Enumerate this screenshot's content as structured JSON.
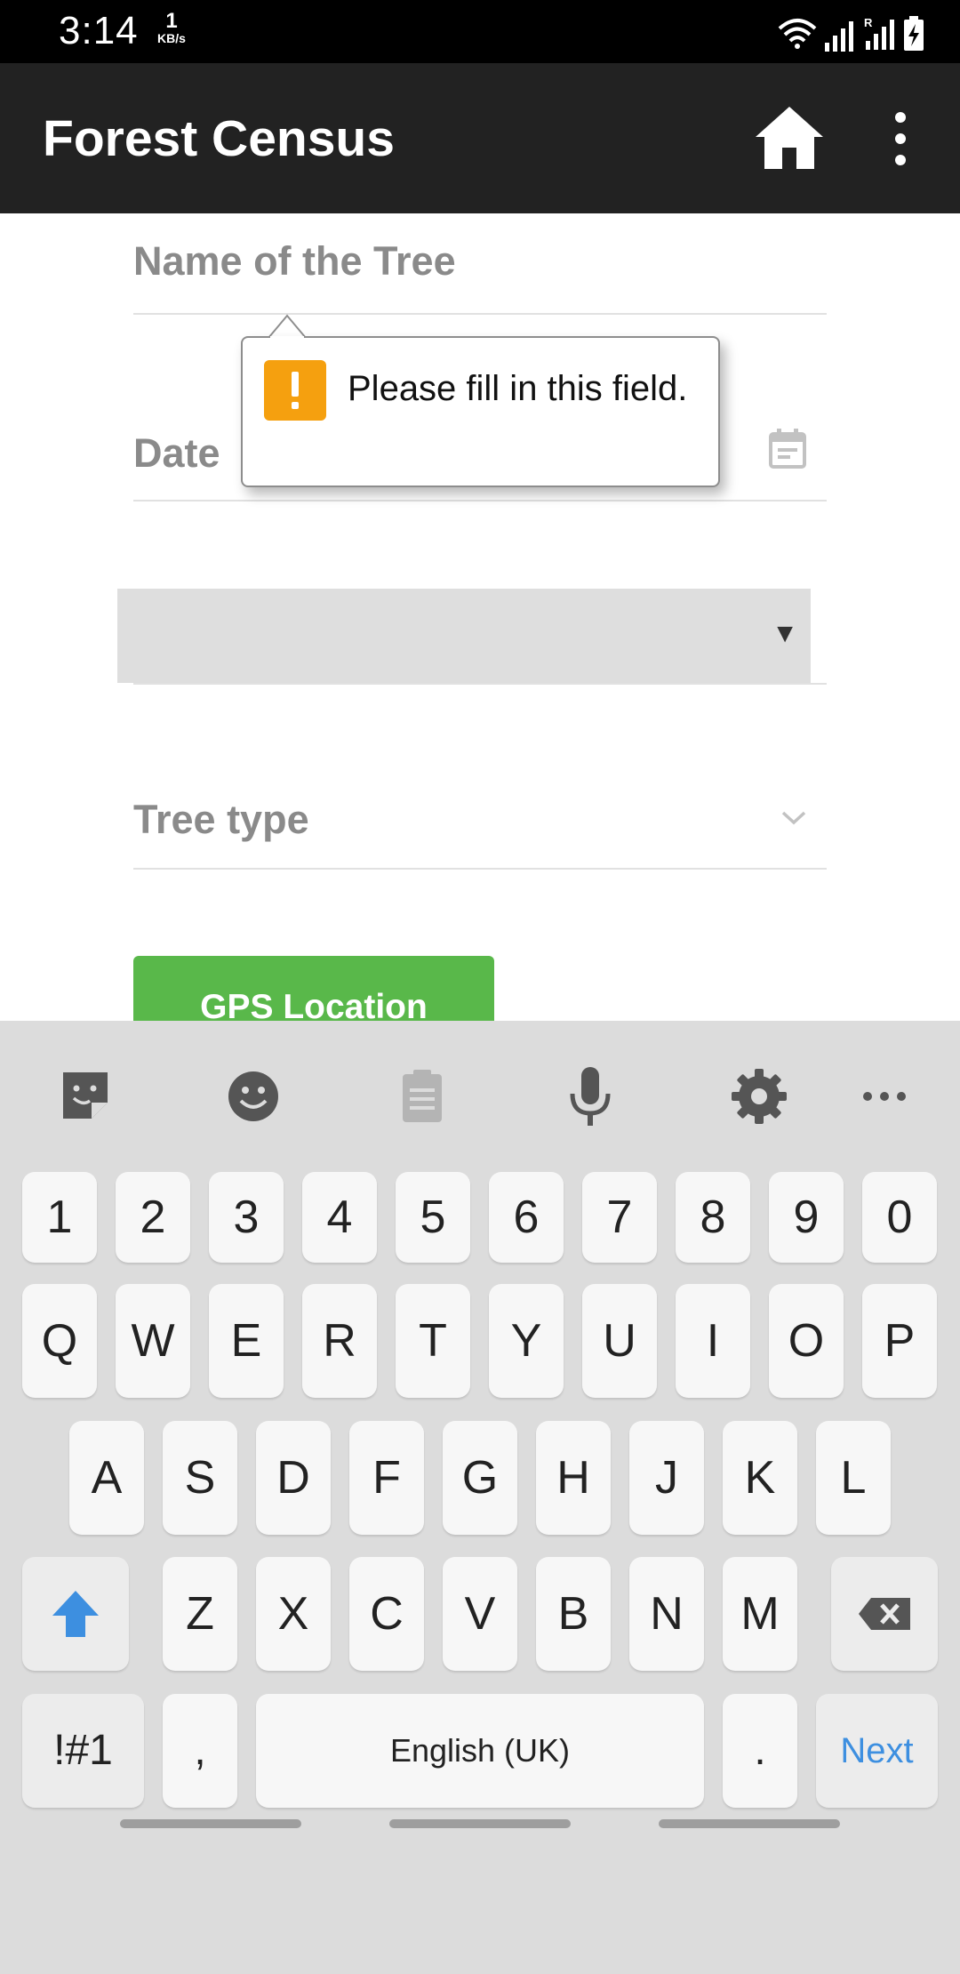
{
  "status_bar": {
    "time": "3:14",
    "speed_value": "1",
    "speed_unit": "KB/s",
    "icons": [
      "wifi-icon",
      "signal-icon",
      "roaming-signal-icon",
      "battery-charging-icon"
    ]
  },
  "app_bar": {
    "title": "Forest Census",
    "actions": [
      "home-icon",
      "more-vert-icon"
    ]
  },
  "form": {
    "tree_name_placeholder": "Name of the Tree",
    "date_label": "Date",
    "date_icon": "calendar-icon",
    "select_value": "",
    "tree_type_placeholder": "Tree type",
    "gps_button": "GPS Location"
  },
  "tooltip": {
    "icon": "warning-icon",
    "message": "Please fill in this field."
  },
  "keyboard": {
    "toolbar_icons": [
      "sticker-icon",
      "emoji-icon",
      "clipboard-icon",
      "microphone-icon",
      "settings-icon",
      "more-horiz-icon"
    ],
    "row_numbers": [
      "1",
      "2",
      "3",
      "4",
      "5",
      "6",
      "7",
      "8",
      "9",
      "0"
    ],
    "row1": [
      "Q",
      "W",
      "E",
      "R",
      "T",
      "Y",
      "U",
      "I",
      "O",
      "P"
    ],
    "row2": [
      "A",
      "S",
      "D",
      "F",
      "G",
      "H",
      "J",
      "K",
      "L"
    ],
    "row3": [
      "Z",
      "X",
      "C",
      "V",
      "B",
      "N",
      "M"
    ],
    "symbols_key": "!#1",
    "comma_key": ",",
    "space_label": "English (UK)",
    "period_key": ".",
    "action_key": "Next"
  },
  "colors": {
    "app_bar": "#222222",
    "gps_button": "#59b84a",
    "warning": "#f5a00f",
    "keyboard_accent": "#3d8fe0"
  }
}
